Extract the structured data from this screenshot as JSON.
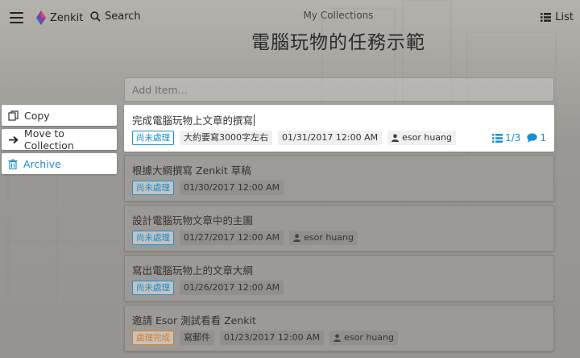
{
  "header": {
    "brand": "Zenkit",
    "search_label": "Search",
    "collection_label": "My Collections",
    "title": "電腦玩物的任務示範",
    "view_label": "List"
  },
  "actions": [
    {
      "label": "Copy",
      "icon": "copy-icon"
    },
    {
      "label": "Move to Collection",
      "icon": "arrow-right-icon"
    },
    {
      "label": "Archive",
      "icon": "trash-icon"
    }
  ],
  "list": {
    "add_placeholder": "Add Item...",
    "items": [
      {
        "title": "完成電腦玩物上文章的撰寫",
        "status": "尚未處理",
        "note": "大約要寫3000字左右",
        "date": "01/31/2017 12:00 AM",
        "user": "esor huang",
        "checklist": "1/3",
        "comments": "1"
      },
      {
        "title": "根據大綱撰寫 Zenkit 草稿",
        "status": "尚未處理",
        "date": "01/30/2017 12:00 AM"
      },
      {
        "title": "設計電腦玩物文章中的主圖",
        "status": "尚未處理",
        "date": "01/27/2017 12:00 AM",
        "user": "esor huang"
      },
      {
        "title": "寫出電腦玩物上的文章大綱",
        "status": "尚未處理",
        "date": "01/26/2017 12:00 AM"
      },
      {
        "title": "邀請 Esor 測試看看 Zenkit",
        "status": "處理完成",
        "note": "寫郵件",
        "date": "01/23/2017 12:00 AM",
        "user": "esor huang"
      }
    ]
  },
  "colors": {
    "accent": "#1a8fcf",
    "done": "#e07a1f"
  }
}
